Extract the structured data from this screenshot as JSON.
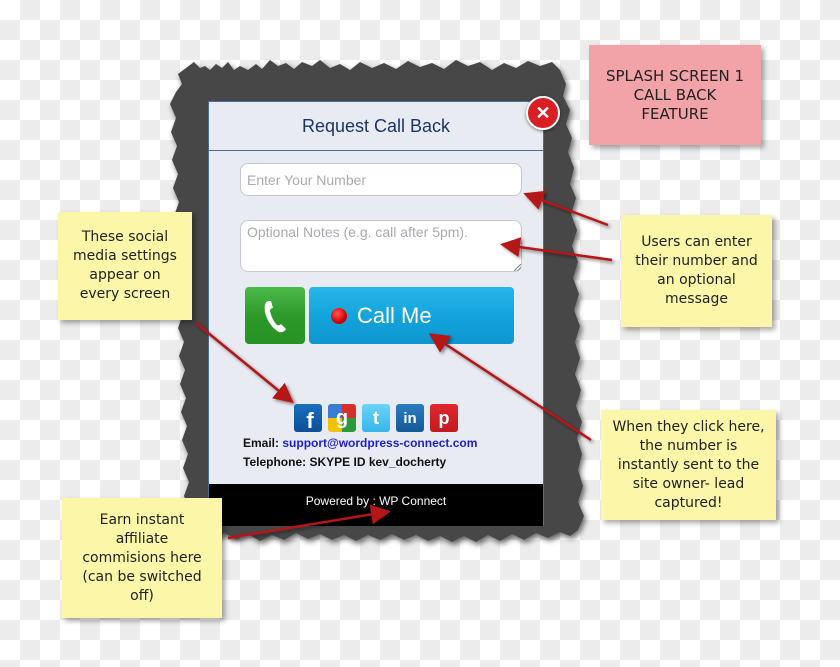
{
  "dialog": {
    "title": "Request Call Back",
    "close_icon": "close-icon",
    "number_input": {
      "placeholder": "Enter Your Number",
      "value": ""
    },
    "notes_input": {
      "placeholder": "Optional Notes (e.g. call after 5pm).",
      "value": ""
    },
    "phone_icon": "phone-handset-icon",
    "call_button_label": "Call Me",
    "social_icons": [
      {
        "name": "facebook",
        "glyph": "f"
      },
      {
        "name": "google-plus",
        "glyph": "g"
      },
      {
        "name": "twitter",
        "glyph": "t"
      },
      {
        "name": "linkedin",
        "glyph": "in"
      },
      {
        "name": "pinterest",
        "glyph": "p"
      }
    ],
    "email_label": "Email:",
    "email_value": "support@wordpress-connect.com",
    "telephone_label": "Telephone:",
    "telephone_value": "SKYPE ID kev_docherty",
    "footer_text": "Powered by : WP Connect"
  },
  "annotations": {
    "splash_title": "SPLASH SCREEN 1\nCALL BACK\nFEATURE",
    "social_note": "These social\nmedia settings\nappear on\nevery screen",
    "input_note": "Users can enter\ntheir number and\nan optional\nmessage",
    "click_note": "When they click here,\nthe number is\ninstantly sent to the\nsite owner- lead\ncaptured!",
    "affiliate_note": "Earn instant\naffiliate\ncommisions here\n(can be switched\noff)"
  },
  "colors": {
    "torn_background": "#474747",
    "modal_bg": "#e8ebf1",
    "header_text": "#1c3566",
    "close_red": "#d91e24",
    "call_blue": "#14a4dc",
    "phone_green": "#2e9a2c",
    "arrow_red": "#b51218",
    "note_yellow": "#fbf6a8",
    "note_pink": "#f1a3a8"
  }
}
